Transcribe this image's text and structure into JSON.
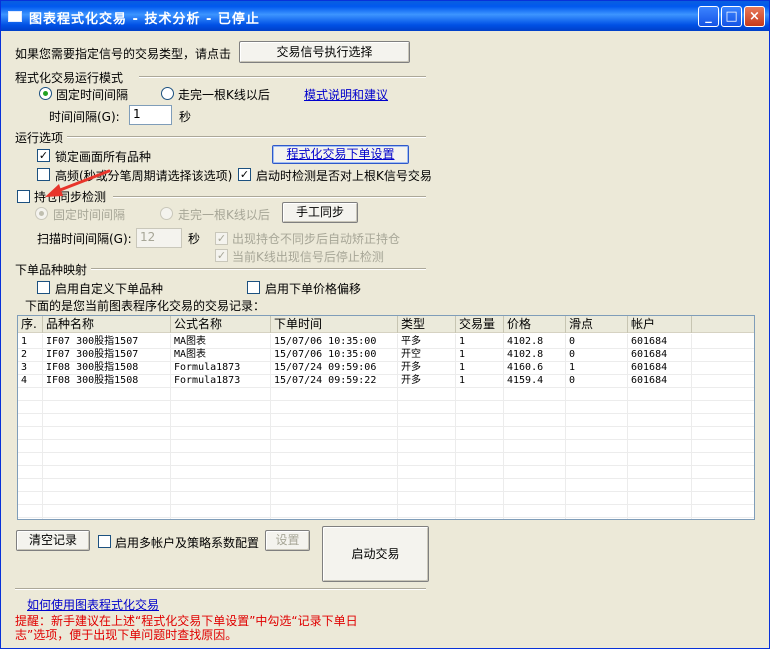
{
  "window": {
    "title": "图表程式化交易 - 技术分析 - 已停止",
    "minimize": "_",
    "maximize": "□",
    "close": "×"
  },
  "signal": {
    "prompt": "如果您需要指定信号的交易类型，请点击",
    "button": "交易信号执行选择"
  },
  "mode": {
    "heading": "程式化交易运行模式",
    "fixed_interval": "固定时间间隔",
    "after_bar": "走完一根K线以后",
    "help_link": "模式说明和建议",
    "interval_label": "时间间隔(G):",
    "interval_value": "1",
    "interval_unit": "秒"
  },
  "options": {
    "heading": "运行选项",
    "lock_all": "锁定画面所有品种",
    "order_settings_button": "程式化交易下单设置",
    "high_freq": "高频(秒或分笔周期请选择该选项)",
    "check_signal_on_start": "启动时检测是否对上根K信号交易"
  },
  "position_sync": {
    "heading": "持仓同步检测",
    "fixed_interval": "固定时间间隔",
    "after_bar": "走完一根K线以后",
    "manual_sync_button": "手工同步",
    "scan_label": "扫描时间间隔(G):",
    "scan_value": "12",
    "scan_unit": "秒",
    "auto_correct": "出现持仓不同步后自动矫正持仓",
    "stop_on_signal": "当前K线出现信号后停止检测"
  },
  "mapping": {
    "heading": "下单品种映射",
    "custom_symbol": "启用自定义下单品种",
    "price_offset": "启用下单价格偏移"
  },
  "records": {
    "caption": "下面的是您当前图表程序化交易的交易记录：",
    "columns": [
      "序.",
      "品种名称",
      "公式名称",
      "下单时间",
      "类型",
      "交易量",
      "价格",
      "滑点",
      "帐户"
    ],
    "rows": [
      [
        "1",
        "IF07 300股指1507",
        "MA图表",
        "15/07/06 10:35:00",
        "平多",
        "1",
        "4102.8",
        "0",
        "601684"
      ],
      [
        "2",
        "IF07 300股指1507",
        "MA图表",
        "15/07/06 10:35:00",
        "开空",
        "1",
        "4102.8",
        "0",
        "601684"
      ],
      [
        "3",
        "IF08 300股指1508",
        "Formula1873",
        "15/07/24 09:59:06",
        "开多",
        "1",
        "4160.6",
        "1",
        "601684"
      ],
      [
        "4",
        "IF08 300股指1508",
        "Formula1873",
        "15/07/24 09:59:22",
        "开多",
        "1",
        "4159.4",
        "0",
        "601684"
      ]
    ]
  },
  "bottom": {
    "clear_button": "清空记录",
    "multi_account": "启用多帐户及策略系数配置",
    "settings_button": "设置",
    "start_button": "启动交易",
    "howto_link": "如何使用图表程式化交易",
    "warning": "提醒：新手建议在上述“程式化交易下单设置”中勾选“记录下单日志”选项，便于出现下单问题时查找原因。"
  },
  "colors": {
    "title_bar": "#0058ee",
    "dialog_bg": "#ece9d8",
    "link": "#0000cc",
    "warning": "#e00000",
    "annotation_arrow": "#e8352b"
  }
}
